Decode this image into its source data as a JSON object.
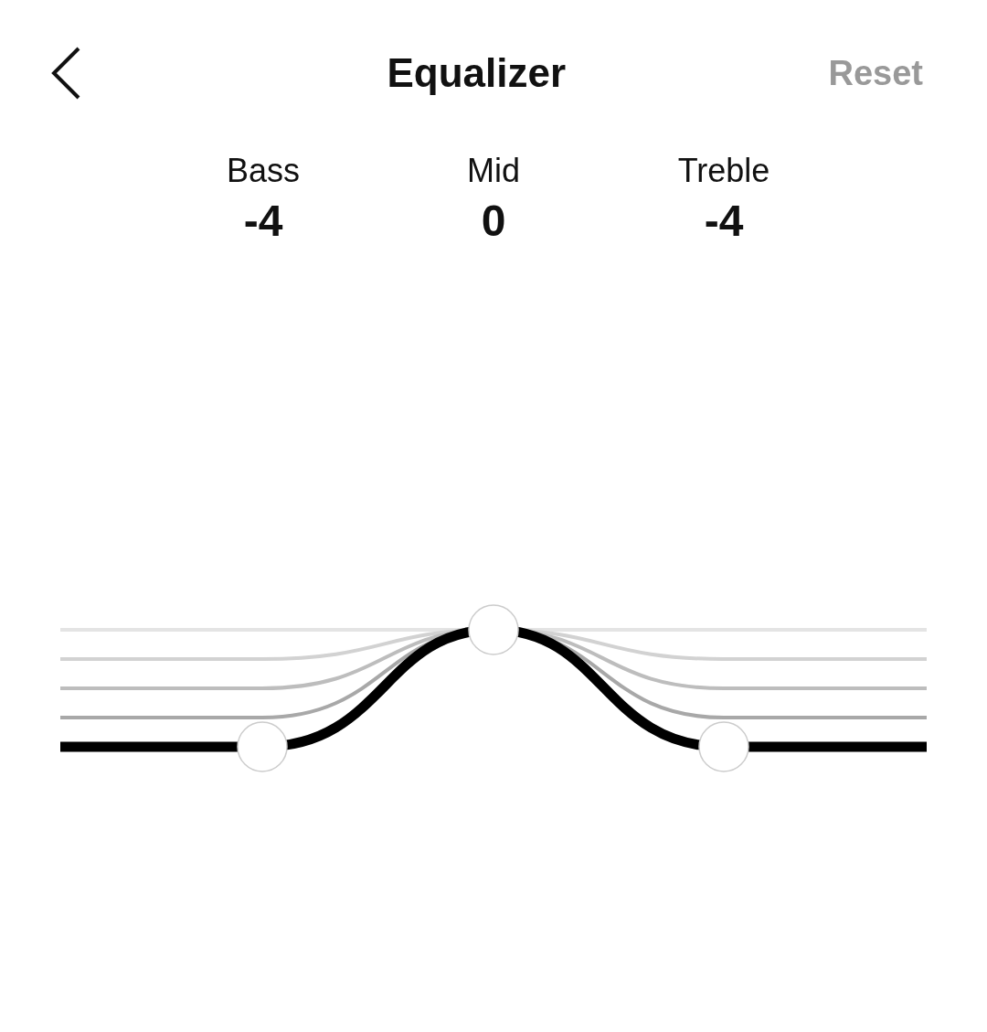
{
  "header": {
    "title": "Equalizer",
    "reset": {
      "label": "Reset",
      "disabled": true
    }
  },
  "bands": [
    {
      "label": "Bass",
      "value": "-4",
      "level": 0
    },
    {
      "label": "Mid",
      "value": "0",
      "level": 1
    },
    {
      "label": "Treble",
      "value": "-4",
      "level": 0
    }
  ]
}
